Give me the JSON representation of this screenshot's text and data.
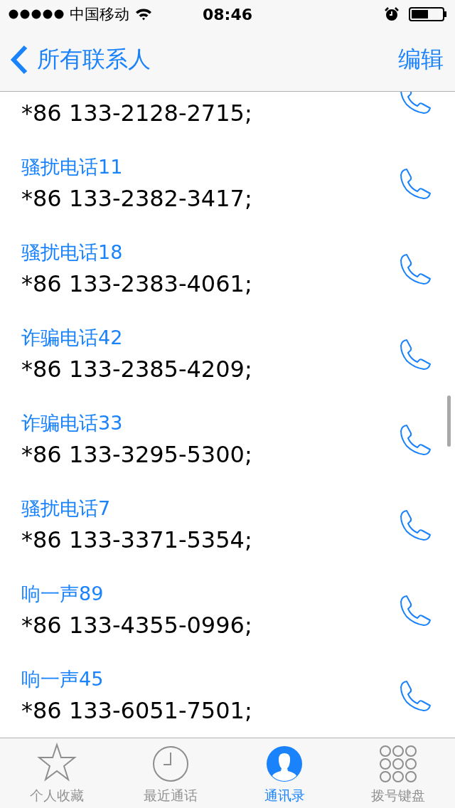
{
  "status_bar": {
    "carrier": "中国移动",
    "time": "08:46",
    "battery": {
      "level": 0.55
    }
  },
  "nav": {
    "back": "所有联系人",
    "action": "编辑"
  },
  "contacts": [
    {
      "number": "*86 133-2128-2715;"
    },
    {
      "name": "骚扰电话11",
      "number": "*86 133-2382-3417;"
    },
    {
      "name": "骚扰电话18",
      "number": "*86 133-2383-4061;"
    },
    {
      "name": "诈骗电话42",
      "number": "*86 133-2385-4209;"
    },
    {
      "name": "诈骗电话33",
      "number": "*86 133-3295-5300;"
    },
    {
      "name": "骚扰电话7",
      "number": "*86 133-3371-5354;"
    },
    {
      "name": "响一声89",
      "number": "*86 133-4355-0996;"
    },
    {
      "name": "响一声45",
      "number": "*86 133-6051-7501;"
    }
  ],
  "tabs": [
    {
      "kind": "favorites",
      "label": "个人收藏",
      "selected": false
    },
    {
      "kind": "recents",
      "label": "最近通话",
      "selected": false
    },
    {
      "kind": "contacts",
      "label": "通讯录",
      "selected": true
    },
    {
      "kind": "keypad",
      "label": "拨号键盘",
      "selected": false
    }
  ]
}
